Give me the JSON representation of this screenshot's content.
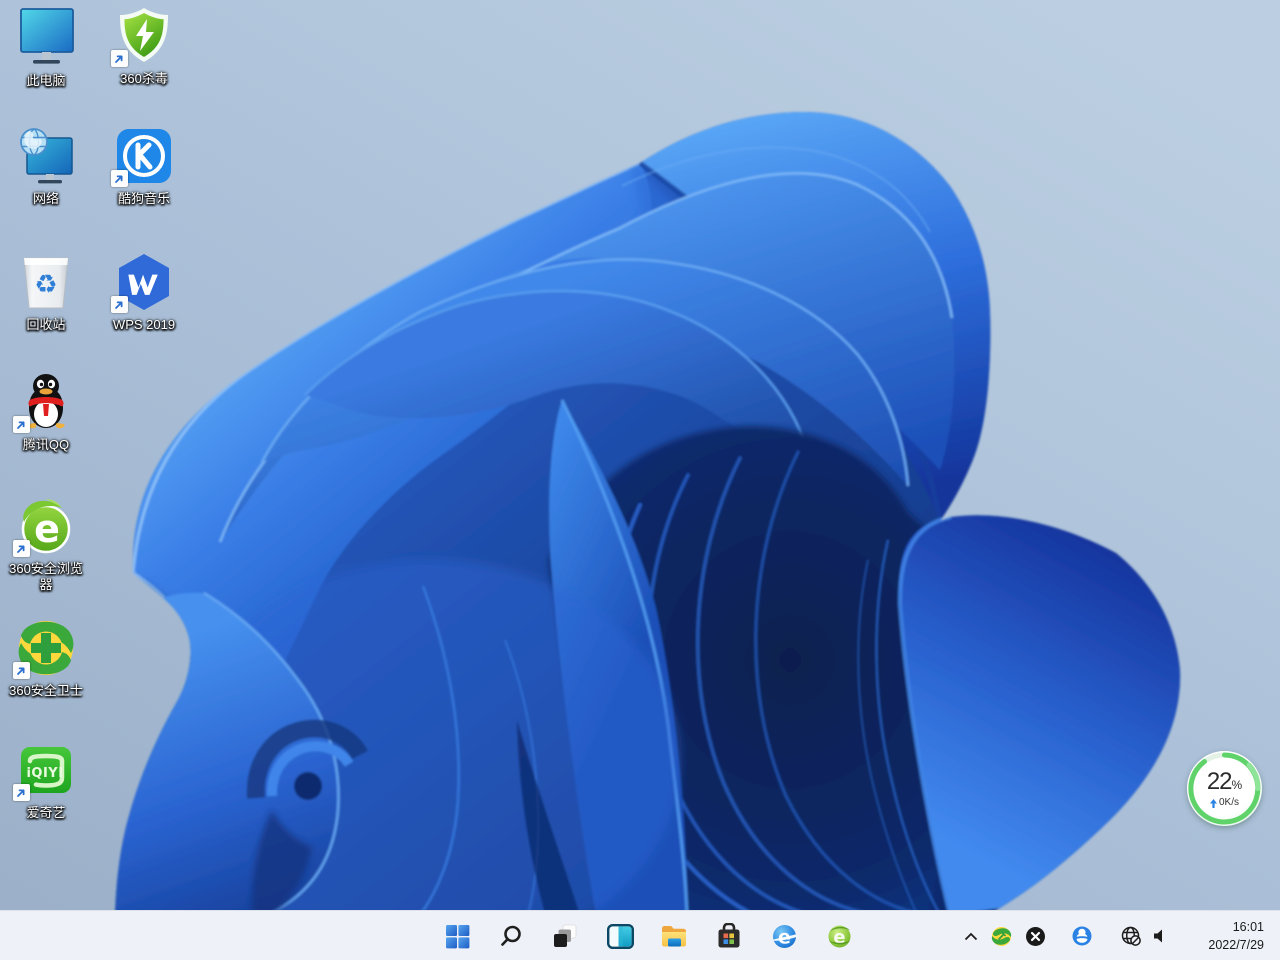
{
  "wallpaper": {
    "name": "windows-11-bloom",
    "background_top": "#cdd5e0",
    "background_bottom": "#a8b8cc",
    "bloom_primary": "#2f74e0"
  },
  "desktop": {
    "icons": [
      {
        "id": "this-pc",
        "label": "此电脑",
        "shortcut": false
      },
      {
        "id": "360-antivirus",
        "label": "360杀毒",
        "shortcut": true
      },
      {
        "id": "network",
        "label": "网络",
        "shortcut": false
      },
      {
        "id": "kugou-music",
        "label": "酷狗音乐",
        "shortcut": true
      },
      {
        "id": "recycle-bin",
        "label": "回收站",
        "shortcut": false
      },
      {
        "id": "wps-2019",
        "label": "WPS 2019",
        "shortcut": true
      },
      {
        "id": "tencent-qq",
        "label": "腾讯QQ",
        "shortcut": true
      },
      {
        "id": "360-browser",
        "label": "360安全浏览器",
        "shortcut": true
      },
      {
        "id": "360-safeguard",
        "label": "360安全卫士",
        "shortcut": true
      },
      {
        "id": "iqiyi",
        "label": "爱奇艺",
        "shortcut": true
      }
    ]
  },
  "taskbar": {
    "buttons": [
      {
        "id": "start",
        "icon": "windows-start-icon"
      },
      {
        "id": "search",
        "icon": "search-icon"
      },
      {
        "id": "task-view",
        "icon": "task-view-icon"
      },
      {
        "id": "widgets",
        "icon": "widgets-icon"
      },
      {
        "id": "file-explorer",
        "icon": "folder-icon"
      },
      {
        "id": "microsoft-store",
        "icon": "store-bag-icon"
      },
      {
        "id": "internet-explorer",
        "icon": "blue-e-browser-icon"
      },
      {
        "id": "360-browser",
        "icon": "green-e-browser-icon"
      }
    ],
    "tray": [
      {
        "id": "hidden-icons",
        "icon": "chevron-up-icon"
      },
      {
        "id": "360-safeguard-tray",
        "icon": "360-ball-icon"
      },
      {
        "id": "close-x-tray",
        "icon": "black-x-icon"
      },
      {
        "id": "qq-tray",
        "icon": "qq-penguin-icon"
      },
      {
        "id": "network-offline",
        "icon": "globe-offline-icon"
      },
      {
        "id": "volume",
        "icon": "speaker-icon"
      }
    ],
    "clock": {
      "time": "16:01",
      "date": "2022/7/29"
    }
  },
  "float_ball": {
    "percent": "22",
    "percent_suffix": "%",
    "speed": "0K/s"
  }
}
